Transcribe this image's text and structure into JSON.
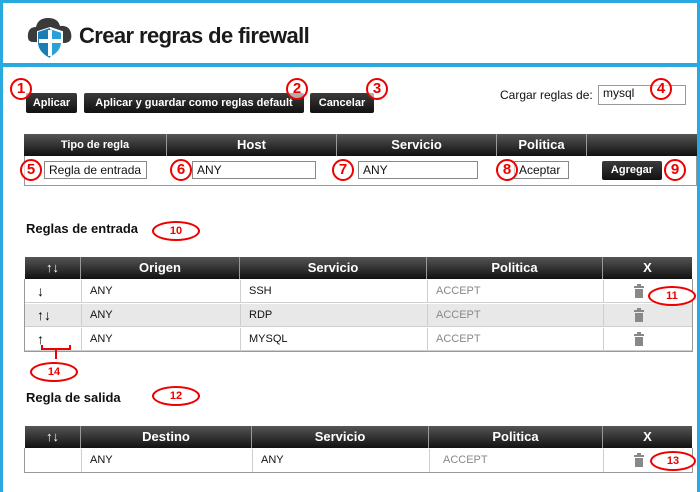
{
  "header": {
    "title": "Crear regras de firewall",
    "logo_icon": "cloud-shield-icon"
  },
  "toolbar": {
    "apply_label": "Aplicar",
    "apply_save_label": "Aplicar y guardar como reglas default",
    "cancel_label": "Cancelar",
    "load_label": "Cargar reglas de:",
    "load_value": "mysql"
  },
  "add_rule": {
    "headers": [
      "Tipo de regla",
      "Host",
      "Servicio",
      "Politica"
    ],
    "rule_type": "Regla de entrada",
    "host": "ANY",
    "service": "ANY",
    "policy": "Aceptar",
    "add_label": "Agregar"
  },
  "inbound": {
    "title": "Reglas de entrada",
    "headers": [
      "Origen",
      "Servicio",
      "Politica",
      "X"
    ],
    "rows": [
      {
        "arrows": "↓",
        "origin": "ANY",
        "service": "SSH",
        "policy": "ACCEPT"
      },
      {
        "arrows": "↑↓",
        "origin": "ANY",
        "service": "RDP",
        "policy": "ACCEPT"
      },
      {
        "arrows": "↑",
        "origin": "ANY",
        "service": "MYSQL",
        "policy": "ACCEPT"
      }
    ]
  },
  "outbound": {
    "title": "Regla de salida",
    "headers": [
      "Destino",
      "Servicio",
      "Politica",
      "X"
    ],
    "rows": [
      {
        "destination": "ANY",
        "service": "ANY",
        "policy": "ACCEPT"
      }
    ]
  },
  "sort_arrows": "↑↓",
  "annotations": [
    "1",
    "2",
    "3",
    "4",
    "5",
    "6",
    "7",
    "8",
    "9",
    "10",
    "11",
    "12",
    "13",
    "14"
  ],
  "colors": {
    "frame_blue": "#2aa8e0",
    "marker_red": "#e00000",
    "header_dark": "#111111"
  }
}
